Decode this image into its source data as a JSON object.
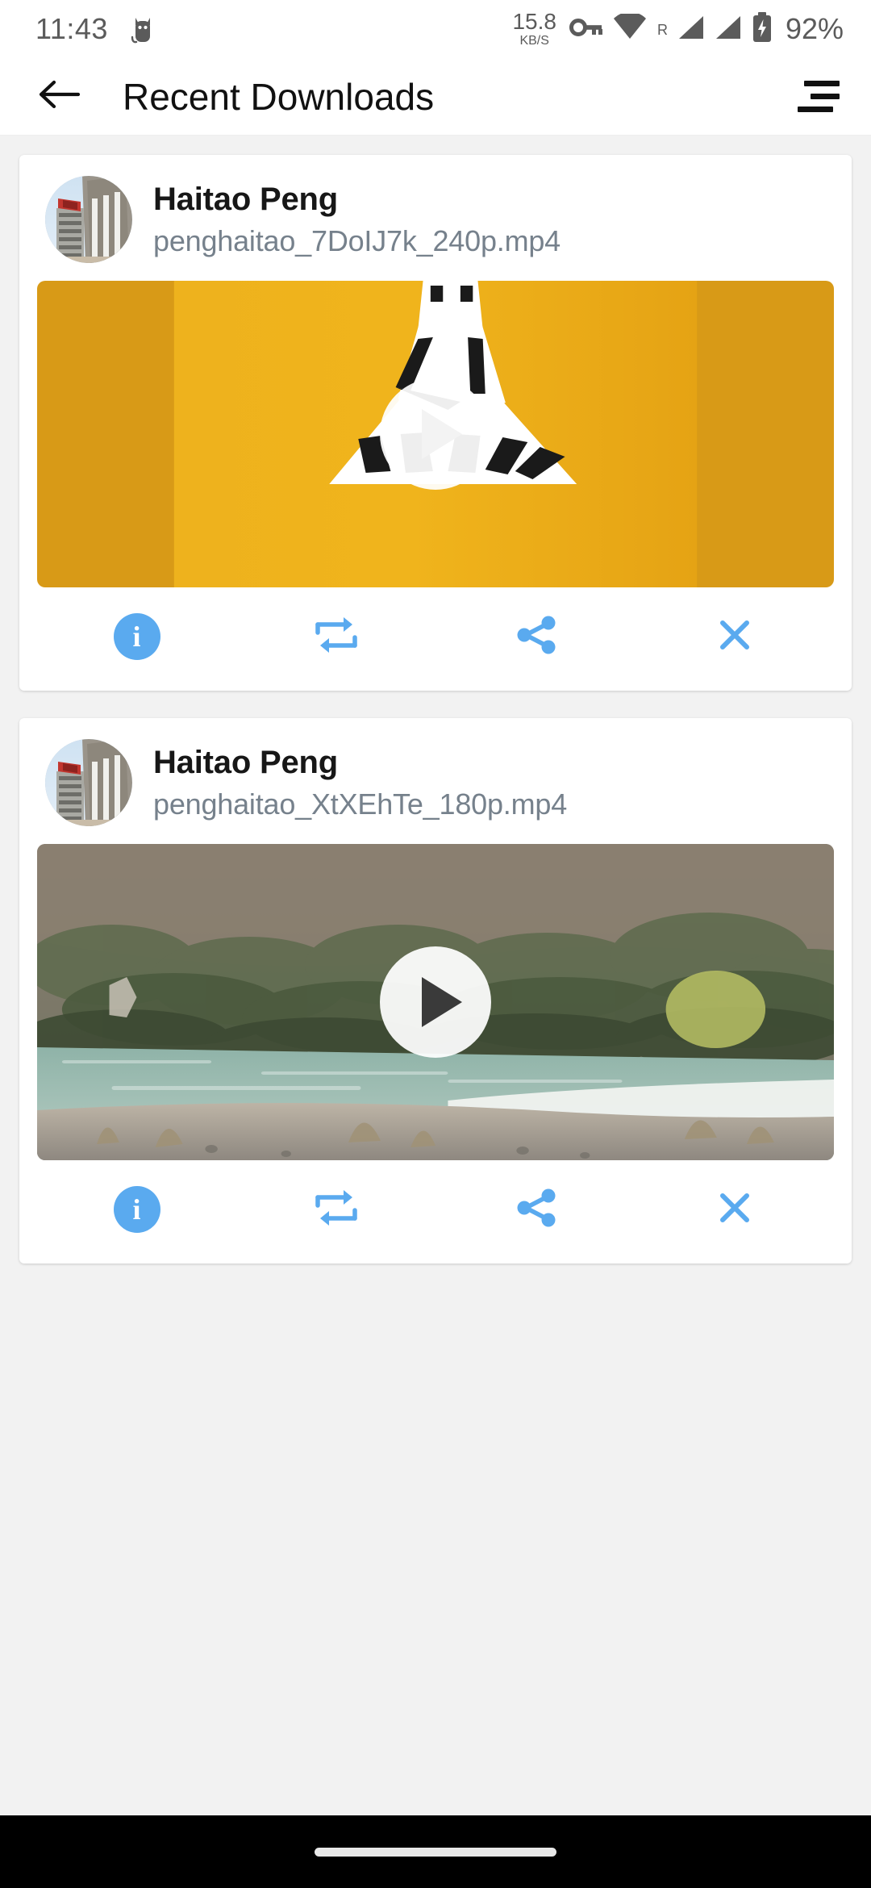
{
  "status_bar": {
    "time": "11:43",
    "left_icon": "cat-icon",
    "network_speed_value": "15.8",
    "network_speed_unit": "KB/S",
    "vpn_icon": "key-icon",
    "wifi_icon": "wifi-icon",
    "roaming_label": "R",
    "signal_icon_1": "signal-bars-icon",
    "signal_icon_2": "signal-bars-icon",
    "battery_icon": "battery-charging-icon",
    "battery_percent": "92%",
    "icon_color": "#5b5b5b"
  },
  "app_bar": {
    "back_icon": "back-arrow-icon",
    "title": "Recent Downloads",
    "menu_icon": "sort-menu-icon"
  },
  "theme": {
    "accent": "#5aaaef",
    "page_bg": "#f2f2f2",
    "card_bg": "#ffffff",
    "title_color": "#111111",
    "subtitle_color": "#76818c"
  },
  "downloads": [
    {
      "uploader": "Haitao Peng",
      "filename": "penghaitao_7DoIJ7k_240p.mp4",
      "avatar_icon": "building-photo-avatar",
      "thumbnail_icon": "yellow-papercut-video-thumbnail",
      "play_icon": "play-icon",
      "actions": [
        {
          "icon": "info-icon",
          "label": "Info"
        },
        {
          "icon": "convert-repeat-icon",
          "label": "Convert"
        },
        {
          "icon": "share-icon",
          "label": "Share"
        },
        {
          "icon": "close-icon",
          "label": "Remove"
        }
      ]
    },
    {
      "uploader": "Haitao Peng",
      "filename": "penghaitao_XtXEhTe_180p.mp4",
      "avatar_icon": "building-photo-avatar",
      "thumbnail_icon": "river-valley-video-thumbnail",
      "play_icon": "play-icon",
      "actions": [
        {
          "icon": "info-icon",
          "label": "Info"
        },
        {
          "icon": "convert-repeat-icon",
          "label": "Convert"
        },
        {
          "icon": "share-icon",
          "label": "Share"
        },
        {
          "icon": "close-icon",
          "label": "Remove"
        }
      ]
    }
  ],
  "nav_bar": {
    "handle": "gesture-home-handle"
  }
}
